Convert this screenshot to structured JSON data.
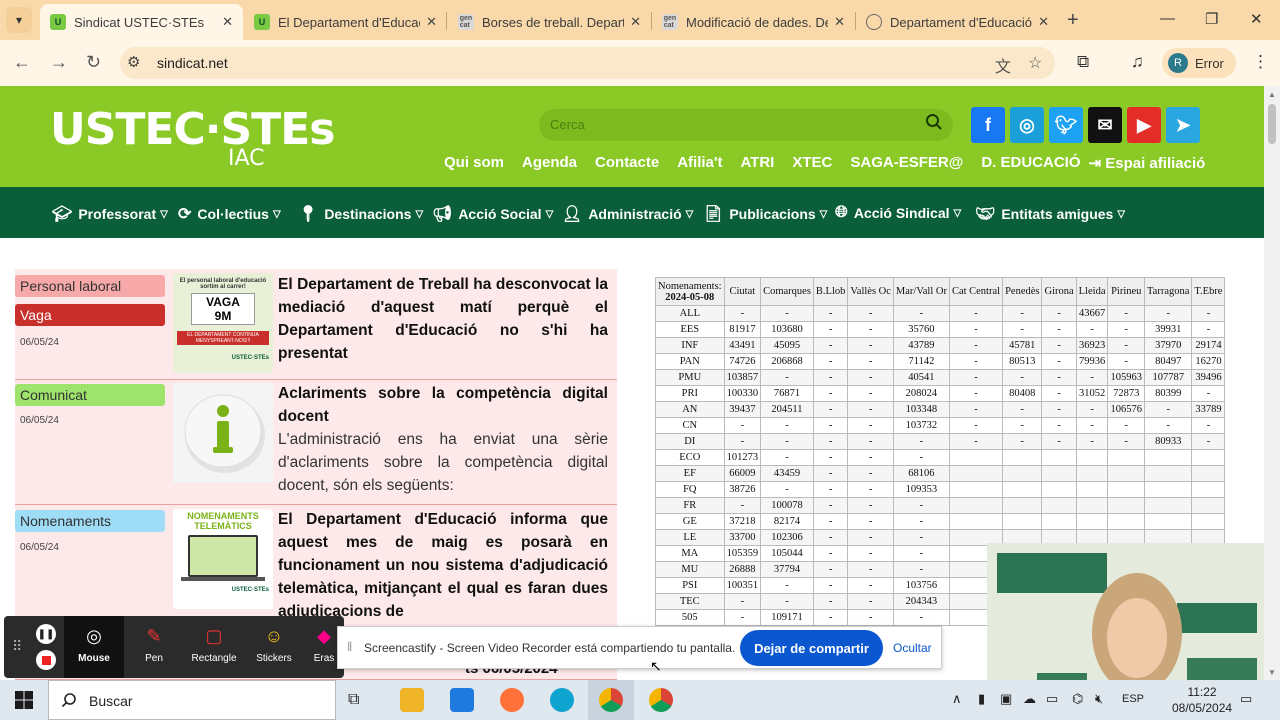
{
  "browser": {
    "tabs": [
      {
        "title": "Sindicat USTEC·STEs",
        "favicon": "ustec-icon",
        "active": true
      },
      {
        "title": "El Departament d'Educac",
        "favicon": "ustec-icon",
        "active": false
      },
      {
        "title": "Borses de treball. Depart",
        "favicon": "gencat-icon",
        "active": false
      },
      {
        "title": "Modificació de dades. De",
        "favicon": "gencat-icon",
        "active": false
      },
      {
        "title": "Departament d'Educació",
        "favicon": "globe-icon",
        "active": false
      }
    ],
    "url": "sindicat.net",
    "profile_label": "Error",
    "profile_initial": "R"
  },
  "site": {
    "logo": "USTEC·STEs",
    "logo_sub": "IAC",
    "search_placeholder": "Cerca",
    "social": [
      "facebook-icon",
      "instagram-icon",
      "twitter-icon",
      "mail-icon",
      "youtube-icon",
      "telegram-icon"
    ],
    "top_links": [
      "Qui som",
      "Agenda",
      "Contacte",
      "Afilia't",
      "ATRI",
      "XTEC",
      "SAGA-ESFER@",
      "D. EDUCACIÓ",
      "Espai afiliació"
    ],
    "nav": [
      "Professorat",
      "Col·lectius",
      "Destinacions",
      "Acció Social",
      "Administració",
      "Publicacions",
      "Acció Sindical",
      "Entitats amigues"
    ]
  },
  "news": [
    {
      "tags": [
        "Personal laboral",
        "Vaga"
      ],
      "date": "06/05/24",
      "thumb_text": [
        "El personal laboral d'educació sortim al carrer!",
        "VAGA",
        "9M",
        "EL DEPARTAMENT CONTINUA MENYSPREANT-NOS!!!",
        "USTEC·STEs"
      ],
      "headline": "El Departament de Treball ha desconvocat la mediació d'aquest matí perquè el Departament d'Educació no s'hi ha presentat",
      "summary": ""
    },
    {
      "tags": [
        "Comunicat"
      ],
      "date": "06/05/24",
      "thumb_text": [],
      "headline": "Aclariments sobre la competència digital docent",
      "summary": "L'administració ens ha enviat una sèrie d'aclariments sobre la competència digital docent, són els següents:"
    },
    {
      "tags": [
        "Nomenaments"
      ],
      "date": "06/05/24",
      "thumb_text": [
        "NOMENAMENTS",
        "TELEMÀTICS",
        "USTEC·STEs"
      ],
      "headline": "El Departament d'Educació informa que aquest mes de maig es posarà en funcionament un nou sistema d'adjudicació telemàtica, mitjançant el qual es faran dues adjudicacions de",
      "summary": ""
    }
  ],
  "table": {
    "header_first": [
      "Nomenaments:",
      "2024-05-08"
    ],
    "columns": [
      "Ciutat",
      "Comarques",
      "B.Llob",
      "Vallès Oc",
      "Mar/Vall Or",
      "Cat Central",
      "Penedès",
      "Girona",
      "Lleida",
      "Pirineu",
      "Tarragona",
      "T.Ebre"
    ],
    "rows": [
      [
        "ALL",
        "-",
        "-",
        "-",
        "-",
        "-",
        "-",
        "-",
        "-",
        "43667",
        "-",
        "-",
        "-"
      ],
      [
        "EES",
        "81917",
        "103680",
        "-",
        "-",
        "35760",
        "-",
        "-",
        "-",
        "-",
        "-",
        "39931",
        "-"
      ],
      [
        "INF",
        "43491",
        "45095",
        "-",
        "-",
        "43789",
        "-",
        "45781",
        "-",
        "36923",
        "-",
        "37970",
        "29174"
      ],
      [
        "PAN",
        "74726",
        "206868",
        "-",
        "-",
        "71142",
        "-",
        "80513",
        "-",
        "79936",
        "-",
        "80497",
        "16270"
      ],
      [
        "PMU",
        "103857",
        "-",
        "-",
        "-",
        "40541",
        "-",
        "-",
        "-",
        "-",
        "105963",
        "107787",
        "39496"
      ],
      [
        "PRI",
        "100330",
        "76871",
        "-",
        "-",
        "208024",
        "-",
        "80408",
        "-",
        "31052",
        "72873",
        "80399",
        "-"
      ],
      [
        "AN",
        "39437",
        "204511",
        "-",
        "-",
        "103348",
        "-",
        "-",
        "-",
        "-",
        "106576",
        "-",
        "33789"
      ],
      [
        "CN",
        "-",
        "-",
        "-",
        "-",
        "103732",
        "-",
        "-",
        "-",
        "-",
        "-",
        "-",
        "-"
      ],
      [
        "DI",
        "-",
        "-",
        "-",
        "-",
        "-",
        "-",
        "-",
        "-",
        "-",
        "-",
        "80933",
        "-"
      ],
      [
        "ECO",
        "101273",
        "-",
        "-",
        "-",
        "-",
        "",
        "",
        "",
        "",
        "",
        "",
        ""
      ],
      [
        "EF",
        "66009",
        "43459",
        "-",
        "-",
        "68106",
        "",
        "",
        "",
        "",
        "",
        "",
        ""
      ],
      [
        "FQ",
        "38726",
        "-",
        "-",
        "-",
        "109353",
        "",
        "",
        "",
        "",
        "",
        "",
        ""
      ],
      [
        "FR",
        "-",
        "100078",
        "-",
        "-",
        "-",
        "",
        "",
        "",
        "",
        "",
        "",
        ""
      ],
      [
        "GE",
        "37218",
        "82174",
        "-",
        "-",
        "-",
        "",
        "",
        "",
        "",
        "",
        "",
        ""
      ],
      [
        "LE",
        "33700",
        "102306",
        "-",
        "-",
        "-",
        "",
        "",
        "",
        "",
        "",
        "",
        ""
      ],
      [
        "MA",
        "105359",
        "105044",
        "-",
        "-",
        "-",
        "",
        "",
        "",
        "",
        "",
        "",
        ""
      ],
      [
        "MU",
        "26888",
        "37794",
        "-",
        "-",
        "-",
        "",
        "",
        "",
        "",
        "",
        "",
        ""
      ],
      [
        "PSI",
        "100351",
        "-",
        "-",
        "-",
        "103756",
        "",
        "",
        "",
        "",
        "",
        "",
        ""
      ],
      [
        "TEC",
        "-",
        "-",
        "-",
        "-",
        "204343",
        "",
        "",
        "",
        "",
        "",
        "",
        ""
      ],
      [
        "505",
        "-",
        "109171",
        "-",
        "-",
        "-",
        "",
        "",
        "",
        "",
        "",
        "",
        ""
      ]
    ]
  },
  "screencast": {
    "tools": [
      "Mouse",
      "Pen",
      "Rectangle",
      "Stickers",
      "Eras"
    ],
    "share_text": "Screencastify - Screen Video Recorder está compartiendo tu pantalla.",
    "stop_button": "Dejar de compartir",
    "hide_link": "Ocultar"
  },
  "behind_overlay_text": "ts 06/05/2024",
  "taskbar": {
    "search_placeholder": "Buscar",
    "lang": "ESP",
    "time": "11:22",
    "date": "08/05/2024"
  },
  "colors": {
    "brand_green": "#8ac926",
    "nav_green": "#0b5e3a",
    "tag_pink": "#f7a8a8",
    "tag_red": "#c9302c",
    "tag_green": "#9ee36b",
    "tag_blue": "#9fdcf5",
    "news_bg": "#fde9e9"
  }
}
